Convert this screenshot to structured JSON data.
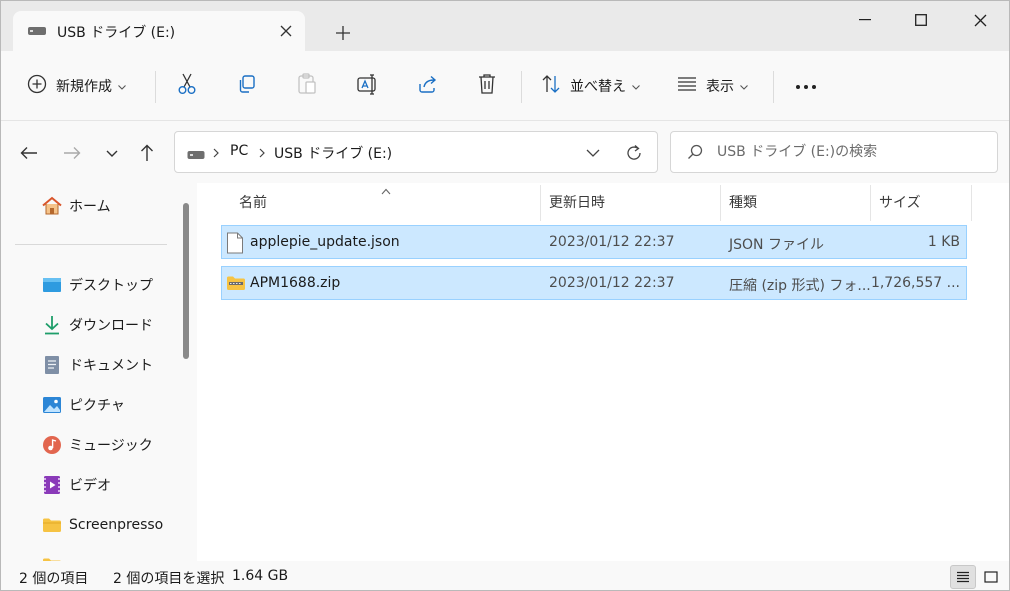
{
  "window": {
    "tab_title": "USB ドライブ (E:)",
    "icons": {
      "tab": "usb-drive-icon",
      "close": "close-icon",
      "new_tab": "plus-icon",
      "minimize": "minimize-icon",
      "maximize": "maximize-icon",
      "window_close": "window-close-icon"
    }
  },
  "toolbar": {
    "new_label": "新規作成",
    "sort_label": "並べ替え",
    "view_label": "表示",
    "icons": [
      "new-icon",
      "cut-icon",
      "copy-icon",
      "paste-icon",
      "rename-icon",
      "share-icon",
      "delete-icon",
      "sort-icon",
      "view-icon",
      "more-icon"
    ]
  },
  "address": {
    "crumbs": [
      "PC",
      "USB ドライブ (E:)"
    ]
  },
  "search": {
    "placeholder": "USB ドライブ (E:)の検索"
  },
  "sidebar": {
    "home": "ホーム",
    "items": [
      {
        "label": "デスクトップ",
        "icon": "desktop-icon",
        "pinned": true
      },
      {
        "label": "ダウンロード",
        "icon": "download-icon",
        "pinned": true
      },
      {
        "label": "ドキュメント",
        "icon": "documents-icon",
        "pinned": true
      },
      {
        "label": "ピクチャ",
        "icon": "pictures-icon",
        "pinned": true
      },
      {
        "label": "ミュージック",
        "icon": "music-icon",
        "pinned": true
      },
      {
        "label": "ビデオ",
        "icon": "videos-icon",
        "pinned": true
      },
      {
        "label": "Screenpresso",
        "icon": "folder-icon",
        "pinned": false
      }
    ]
  },
  "files": {
    "columns": [
      "名前",
      "更新日時",
      "種類",
      "サイズ"
    ],
    "rows": [
      {
        "name": "applepie_update.json",
        "modified": "2023/01/12 22:37",
        "type": "JSON ファイル",
        "size": "1 KB",
        "icon": "json-file-icon",
        "selected": true
      },
      {
        "name": "APM1688.zip",
        "modified": "2023/01/12 22:37",
        "type": "圧縮 (zip 形式) フォ...",
        "size": "1,726,557 ...",
        "icon": "zip-folder-icon",
        "selected": true
      }
    ]
  },
  "status": {
    "item_count": "2 個の項目",
    "selection": "2 個の項目を選択",
    "selection_size": "1.64 GB"
  },
  "colors": {
    "selection_bg": "#cce8ff",
    "selection_border": "#99d1ff",
    "accent": "#0067c0"
  }
}
